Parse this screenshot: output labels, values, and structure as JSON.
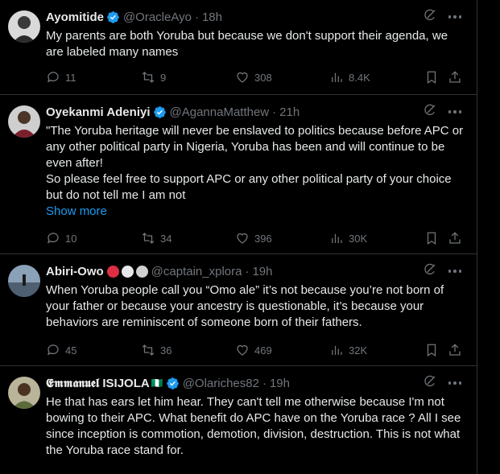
{
  "tweets": [
    {
      "name": "Ayomitide",
      "handle": "@OracleAyo",
      "time": "18h",
      "text": "My parents are both Yoruba but because we don't support their agenda, we are labeled many names",
      "show_more": "",
      "replies": "11",
      "reposts": "9",
      "likes": "308",
      "views": "8.4K"
    },
    {
      "name": "Oyekanmi Adeniyi",
      "handle": "@AgannaMatthew",
      "time": "21h",
      "text": "\"The Yoruba heritage will never be enslaved to politics because before APC or any other political party in Nigeria, Yoruba has been and will continue to be even after!\nSo please feel free to support APC or any other political party of your choice but do not tell me I am not",
      "show_more": "Show more",
      "replies": "10",
      "reposts": "34",
      "likes": "396",
      "views": "30K"
    },
    {
      "name": "Abiri-Owo",
      "handle": "@captain_xplora",
      "time": "19h",
      "text": "When Yoruba people call you “Omo ale” it’s not because you’re not born of your father or because your ancestry is questionable, it’s because your behaviors are reminiscent of someone born of their fathers.",
      "show_more": "",
      "replies": "45",
      "reposts": "36",
      "likes": "469",
      "views": "32K"
    },
    {
      "name": "𝕰𝖒𝖒𝖆𝖓𝖚𝖊𝖑 ISIJOLA",
      "name_suffix": "🇳🇬",
      "handle": "@Olariches82",
      "time": "19h",
      "text": "He that has ears let him hear. They can't tell me otherwise because I'm not bowing to their APC. What benefit do APC have on the Yoruba race ? All I see since inception is commotion, demotion, division, destruction. This is not what the Yoruba race stand for.",
      "show_more": ""
    }
  ],
  "separator": "·",
  "colors": {
    "background": "#000000",
    "text": "#e7e9ea",
    "muted": "#71767b",
    "link": "#1d9bf0",
    "verified": "#1d9bf0",
    "border": "#2f3336"
  },
  "icons": [
    "verified-badge-icon",
    "grok-icon",
    "more-icon",
    "reply-icon",
    "repost-icon",
    "like-icon",
    "views-icon",
    "bookmark-icon",
    "share-icon"
  ]
}
